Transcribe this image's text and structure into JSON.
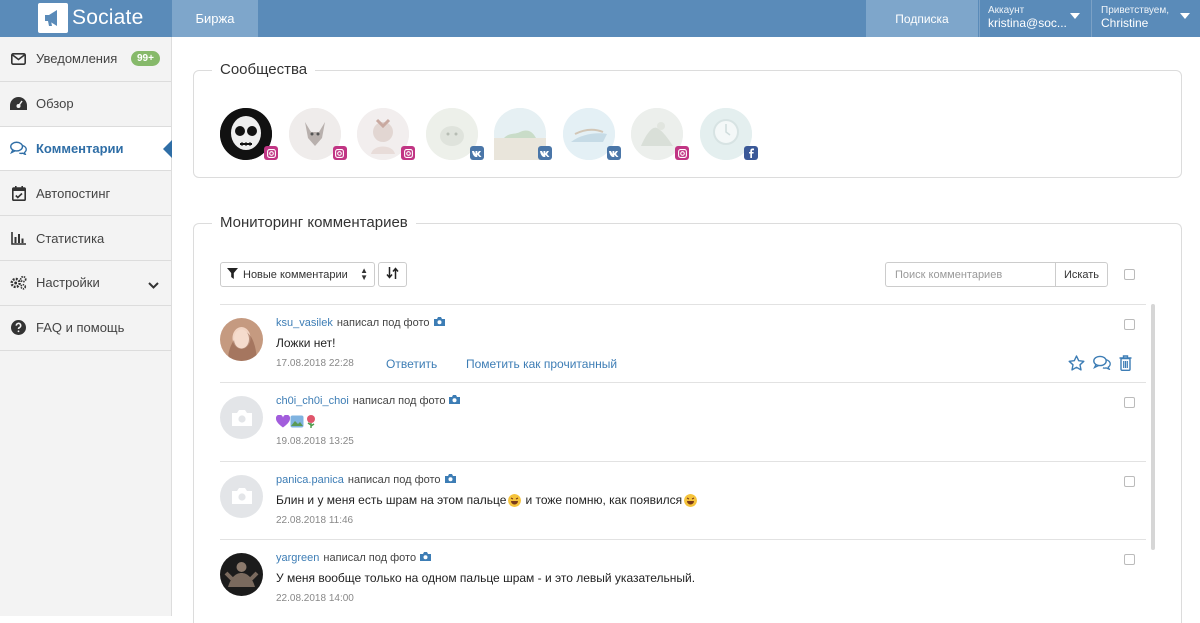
{
  "header": {
    "logo_text": "Sociate",
    "nav_birzha": "Биржа",
    "nav_subscription": "Подписка",
    "account_label": "Аккаунт",
    "account_email": "kristina@soc...",
    "greeting_label": "Приветствуем,",
    "greeting_name": "Christine",
    "colors": {
      "bar": "#5a8bb9",
      "bar_active": "#7ea6cb"
    }
  },
  "sidebar": {
    "items": [
      {
        "label": "Уведомления",
        "icon": "envelope-icon",
        "badge": "99+"
      },
      {
        "label": "Обзор",
        "icon": "dashboard-icon"
      },
      {
        "label": "Комментарии",
        "icon": "comments-icon",
        "active": true
      },
      {
        "label": "Автопостинг",
        "icon": "calendar-check-icon"
      },
      {
        "label": "Статистика",
        "icon": "bar-chart-icon"
      },
      {
        "label": "Настройки",
        "icon": "gears-icon",
        "expand": "chevron-down-icon"
      },
      {
        "label": "FAQ и помощь",
        "icon": "question-circle-icon"
      }
    ],
    "accent": "#2f6ea6",
    "badge_color": "#86b96a"
  },
  "communities": {
    "title": "Сообщества",
    "items": [
      {
        "network": "instagram"
      },
      {
        "network": "instagram"
      },
      {
        "network": "instagram"
      },
      {
        "network": "vk"
      },
      {
        "network": "vk"
      },
      {
        "network": "vk"
      },
      {
        "network": "instagram"
      },
      {
        "network": "facebook"
      }
    ]
  },
  "monitoring": {
    "title": "Мониторинг комментариев",
    "filter_label": "Новые комментарии",
    "search_placeholder": "Поиск комментариев",
    "search_button": "Искать",
    "comments": [
      {
        "user": "ksu_vasilek",
        "action": "написал под фото",
        "text": "Ложки нет!",
        "date": "17.08.2018 22:28",
        "reply": "Ответить",
        "mark_read": "Пометить как прочитанный"
      },
      {
        "user": "ch0i_ch0i_choi",
        "action": "написал под фото",
        "text": "",
        "emojis": [
          "purple-heart",
          "picture",
          "rose"
        ],
        "date": "19.08.2018 13:25"
      },
      {
        "user": "panica.panica",
        "action": "написал под фото",
        "text_a": "Блин и у меня есть шрам на этом пальце",
        "text_b": "и тоже помню, как появился",
        "date": "22.08.2018 11:46"
      },
      {
        "user": "yargreen",
        "action": "написал под фото",
        "text": "У меня вообще только на одном пальце шрам - и это левый указательный.",
        "date": "22.08.2018 14:00"
      }
    ],
    "link_color": "#3d7db5"
  }
}
